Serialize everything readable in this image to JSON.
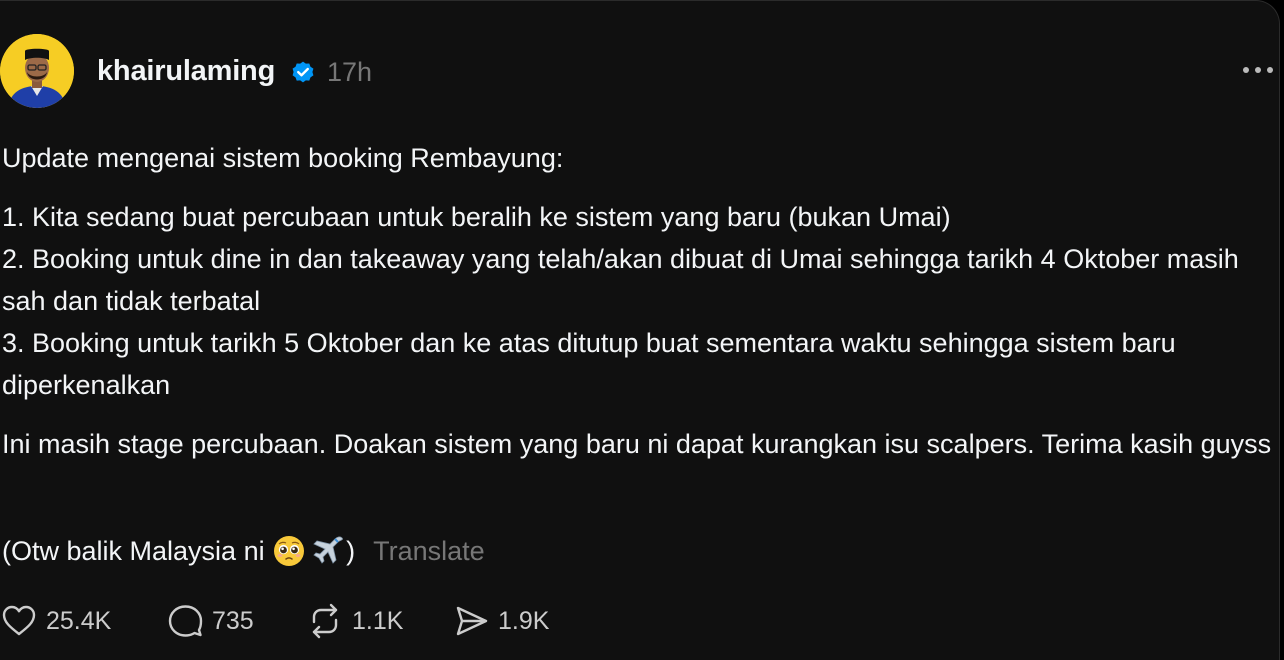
{
  "post": {
    "username": "khairulaming",
    "time": "17h",
    "paragraphs": [
      "Update mengenai sistem booking Rembayung:",
      "1. Kita sedang buat percubaan untuk beralih ke sistem yang baru (bukan Umai)\n2. Booking untuk dine in dan takeaway yang telah/akan dibuat di Umai sehingga tarikh 4 Oktober masih sah dan tidak terbatal\n3. Booking untuk tarikh 5 Oktober dan ke atas ditutup buat sementara waktu sehingga sistem baru diperkenalkan",
      "Ini masih stage percubaan. Doakan sistem yang baru ni dapat kurangkan isu scalpers. Terima kasih guyss"
    ],
    "last_line_prefix": "(Otw balik Malaysia ni ",
    "last_line_suffix": ")",
    "translate_label": "Translate"
  },
  "actions": {
    "likes": "25.4K",
    "replies": "735",
    "reposts": "1.1K",
    "shares": "1.9K"
  },
  "colors": {
    "background": "#101010",
    "text": "#f3f5f7",
    "muted": "#777777",
    "verified": "#0095f6",
    "avatar_bg": "#f6cd24"
  },
  "icons": {
    "verified": "verified-badge-icon",
    "more": "more-dots-icon",
    "like": "heart-icon",
    "reply": "comment-icon",
    "repost": "repost-icon",
    "share": "send-icon"
  }
}
